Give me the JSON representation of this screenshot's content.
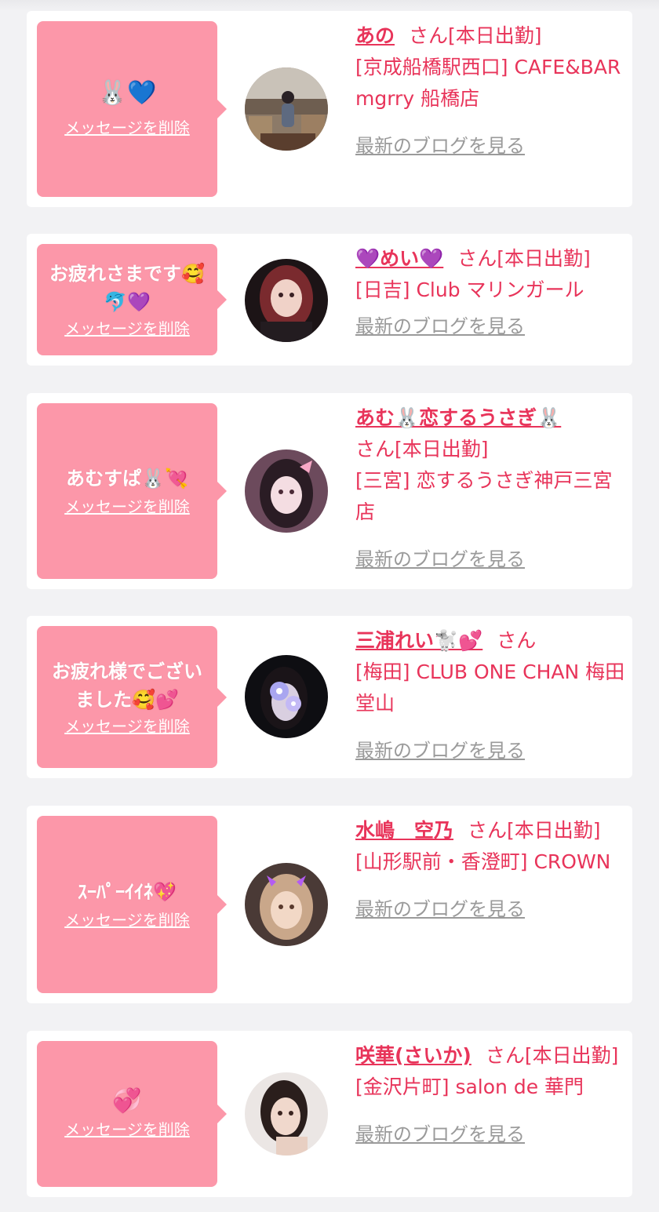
{
  "delete_label": "メッセージを削除",
  "blog_label": "最新のブログを見る",
  "colors": {
    "bubble": "#fc97a9",
    "accent": "#e8345a",
    "link_gray": "#9a9a9a",
    "card": "#ffffff",
    "background": "#f2f2f4"
  },
  "cards": [
    {
      "message": "🐰💙",
      "name": "あの",
      "suffix": "さん[本日出勤]",
      "shop": "[京成船橋駅西口] CAFE&BAR mgrry 船橋店",
      "avatar": "avatar-photo-cafe"
    },
    {
      "message": "お疲れさまです🥰🐬💜",
      "name": "💜めい💜",
      "suffix": "さん[本日出勤]",
      "shop": "[日吉] Club マリンガール",
      "avatar": "avatar-photo-red-hair"
    },
    {
      "message": "あむすぱ🐰💘",
      "name": "あむ🐰恋するうさぎ🐰",
      "suffix": "さん[本日出勤]",
      "shop": "[三宮] 恋するうさぎ神戸三宮店",
      "avatar": "avatar-photo-pink-bow"
    },
    {
      "message": "お疲れ様でございました🥰💕",
      "name": "三浦れい🐩💕",
      "suffix": "さん",
      "shop": "[梅田] CLUB ONE CHAN 梅田堂山",
      "avatar": "avatar-photo-flowers"
    },
    {
      "message": "ｽｰﾊﾟｰｲｲﾈ💖",
      "name": "水嶋　空乃",
      "suffix": "さん[本日出勤]",
      "shop": "[山形駅前・香澄町] CROWN",
      "avatar": "avatar-photo-devil-horns"
    },
    {
      "message": "💞",
      "name": "咲華(さいか)",
      "suffix": "さん[本日出勤]",
      "shop": "[金沢片町] salon de 華門",
      "avatar": "avatar-photo-portrait"
    }
  ]
}
